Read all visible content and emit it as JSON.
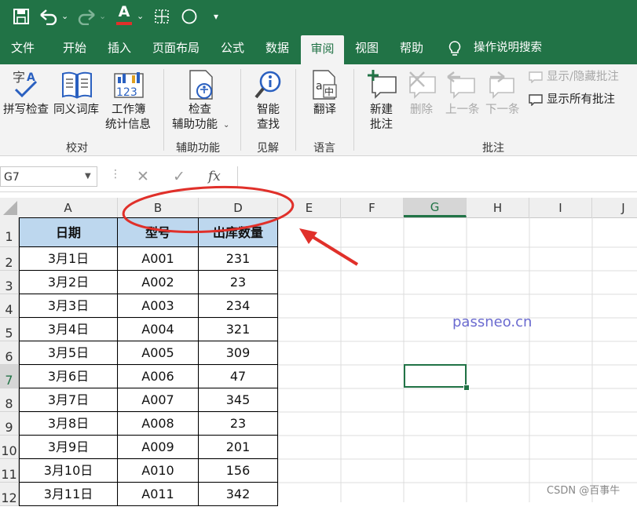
{
  "ribbon_tabs": [
    "文件",
    "开始",
    "插入",
    "页面布局",
    "公式",
    "数据",
    "审阅",
    "视图",
    "帮助"
  ],
  "tell_me": "操作说明搜索",
  "ribbon": {
    "spelling": "拼写检查",
    "thesaurus": "同义词库",
    "workbook_stats_1": "工作簿",
    "workbook_stats_2": "统计信息",
    "check_access_1": "检查",
    "check_access_2": "辅助功能",
    "smart_lookup_1": "智能",
    "smart_lookup_2": "查找",
    "translate": "翻译",
    "new_comment_1": "新建",
    "new_comment_2": "批注",
    "delete": "删除",
    "previous": "上一条",
    "next": "下一条",
    "show_hide_comment": "显示/隐藏批注",
    "show_all_comments": "显示所有批注",
    "groups": [
      "校对",
      "辅助功能",
      "见解",
      "语言",
      "批注"
    ]
  },
  "formula_bar": {
    "name_box": "G7",
    "fx": "fx",
    "formula": ""
  },
  "columns": [
    "A",
    "B",
    "D",
    "E",
    "F",
    "G",
    "H",
    "I",
    "J"
  ],
  "selected_column": "G",
  "rows": [
    "1",
    "2",
    "3",
    "4",
    "5",
    "6",
    "7",
    "8",
    "9",
    "10",
    "11",
    "12"
  ],
  "selected_row": "7",
  "table": {
    "headers": [
      "日期",
      "型号",
      "出库数量"
    ],
    "data": [
      [
        "3月1日",
        "A001",
        "231"
      ],
      [
        "3月2日",
        "A002",
        "23"
      ],
      [
        "3月3日",
        "A003",
        "234"
      ],
      [
        "3月4日",
        "A004",
        "321"
      ],
      [
        "3月5日",
        "A005",
        "309"
      ],
      [
        "3月6日",
        "A006",
        "47"
      ],
      [
        "3月7日",
        "A007",
        "345"
      ],
      [
        "3月8日",
        "A008",
        "23"
      ],
      [
        "3月9日",
        "A009",
        "201"
      ],
      [
        "3月10日",
        "A010",
        "156"
      ],
      [
        "3月11日",
        "A011",
        "342"
      ]
    ]
  },
  "watermark": "passneo.cn",
  "credit": "CSDN @百事牛",
  "colors": {
    "excel_green": "#217346",
    "header_fill": "#bdd7ee",
    "annotation_red": "#e0302a",
    "watermark_blue": "#6b6bd0"
  }
}
